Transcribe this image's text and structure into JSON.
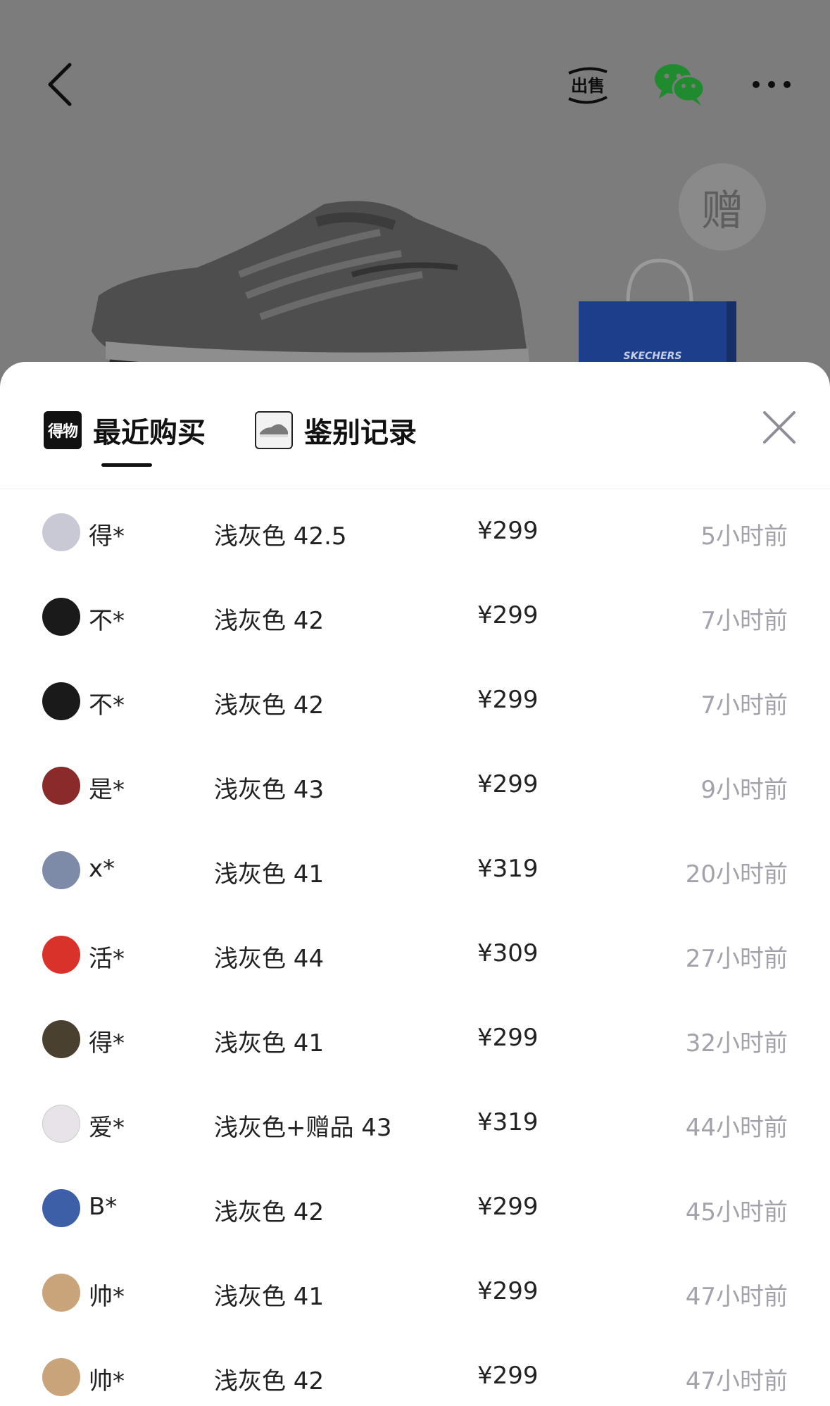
{
  "header": {
    "back_icon": "chevron-left-icon",
    "sell_label": "出售",
    "share_icon": "wechat-icon",
    "more_icon": "more-icon",
    "gift_badge": "赠",
    "bag_brand": "SKECHERS"
  },
  "sheet": {
    "tabs": [
      {
        "label": "最近购买",
        "logo_text": "得物",
        "active": true
      },
      {
        "label": "鉴别记录",
        "active": false
      }
    ],
    "close_icon": "close-icon",
    "purchases": [
      {
        "user": "得*",
        "spec": "浅灰色 42.5",
        "price": "¥299",
        "time": "5小时前",
        "avatar_color": "#c9c9d6"
      },
      {
        "user": "不*",
        "spec": "浅灰色 42",
        "price": "¥299",
        "time": "7小时前",
        "avatar_color": "#1a1a1a"
      },
      {
        "user": "不*",
        "spec": "浅灰色 42",
        "price": "¥299",
        "time": "7小时前",
        "avatar_color": "#1a1a1a"
      },
      {
        "user": "是*",
        "spec": "浅灰色 43",
        "price": "¥299",
        "time": "9小时前",
        "avatar_color": "#8a2a2a"
      },
      {
        "user": "x*",
        "spec": "浅灰色 41",
        "price": "¥319",
        "time": "20小时前",
        "avatar_color": "#7d8aa8"
      },
      {
        "user": "活*",
        "spec": "浅灰色 44",
        "price": "¥309",
        "time": "27小时前",
        "avatar_color": "#d8322a"
      },
      {
        "user": "得*",
        "spec": "浅灰色 41",
        "price": "¥299",
        "time": "32小时前",
        "avatar_color": "#4a4030"
      },
      {
        "user": "爱*",
        "spec": "浅灰色+赠品 43",
        "price": "¥319",
        "time": "44小时前",
        "avatar_color": "#e8e3e8"
      },
      {
        "user": "B*",
        "spec": "浅灰色 42",
        "price": "¥299",
        "time": "45小时前",
        "avatar_color": "#3c5fa8"
      },
      {
        "user": "帅*",
        "spec": "浅灰色 41",
        "price": "¥299",
        "time": "47小时前",
        "avatar_color": "#c9a47a"
      },
      {
        "user": "帅*",
        "spec": "浅灰色 42",
        "price": "¥299",
        "time": "47小时前",
        "avatar_color": "#c9a47a"
      }
    ]
  }
}
